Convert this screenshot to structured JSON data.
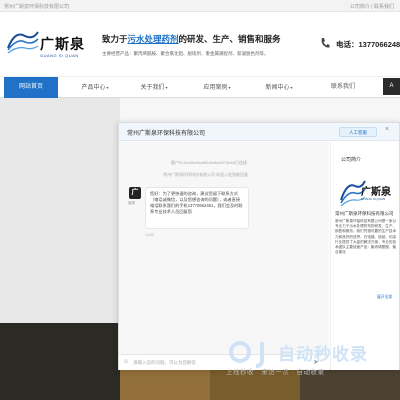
{
  "topbar": {
    "left": "常州广斯泉环保科技有限公司",
    "right": "公司简介 | 联系我们"
  },
  "header": {
    "brand": "广斯泉",
    "brand_en": "GUANG SI QUAN",
    "slogan_pre": "致力于",
    "slogan_hl": "污水处理药剂",
    "slogan_post": "的研发、生产、销售和服务",
    "main_products": "主要经营产品：聚丙烯酰胺、聚合氯化铝、脱硫剂、重金属捕捉剂、絮凝脱色剂等。",
    "phone": "电话：13770662481"
  },
  "nav": {
    "items": [
      {
        "label": "网站首页",
        "active": true
      },
      {
        "label": "产品中心",
        "active": false
      },
      {
        "label": "关于我们",
        "active": false
      },
      {
        "label": "应用案例",
        "active": false
      },
      {
        "label": "新闻中心",
        "active": false
      },
      {
        "label": "联系我们",
        "active": false
      }
    ],
    "widget": "A"
  },
  "chat": {
    "title": "常州广斯泉环保科技有限公司",
    "human_button": "人工客服",
    "sys_line_1": "客户ID:f4a3be8ca5f2d94be8273e65已连接",
    "sys_line_2": "常州广斯泉环保科技有限公司 欢迎入驻智能回复",
    "bot_avatar": "广",
    "bot_name": "客服",
    "bubble": "您好：为了更快速的咨询，建议您留下联系方式（电话或微信，以及您想咨询的问题），或者直接电话联系我们的手机13770662481，我们会及时联系专业技术人员回复您",
    "bubble_time": "14:03",
    "input_placeholder": "请输入您的问题，可以为您解答",
    "side_title": "公司简介",
    "side_brand": "广斯泉",
    "side_brand_en": "GUANG SI QUAN",
    "side_company": "常州广斯泉环保科技有限公司",
    "side_desc": "常州广斯泉环保科技有限公司是一家以专业力于污水处理药剂的研发、生产、销售和服务。我们凭借可靠的生产技术力和良好的信誉，在电镀、造纸、印染行业提供了大量的解决方案，专业的技术团队主要经营产品：聚丙烯酰胺、聚合氯化",
    "side_more": "展开全部"
  },
  "watermark": {
    "text": "自动秒收录",
    "sub": "上线秒收 · 来访一次 · 自动收录"
  }
}
